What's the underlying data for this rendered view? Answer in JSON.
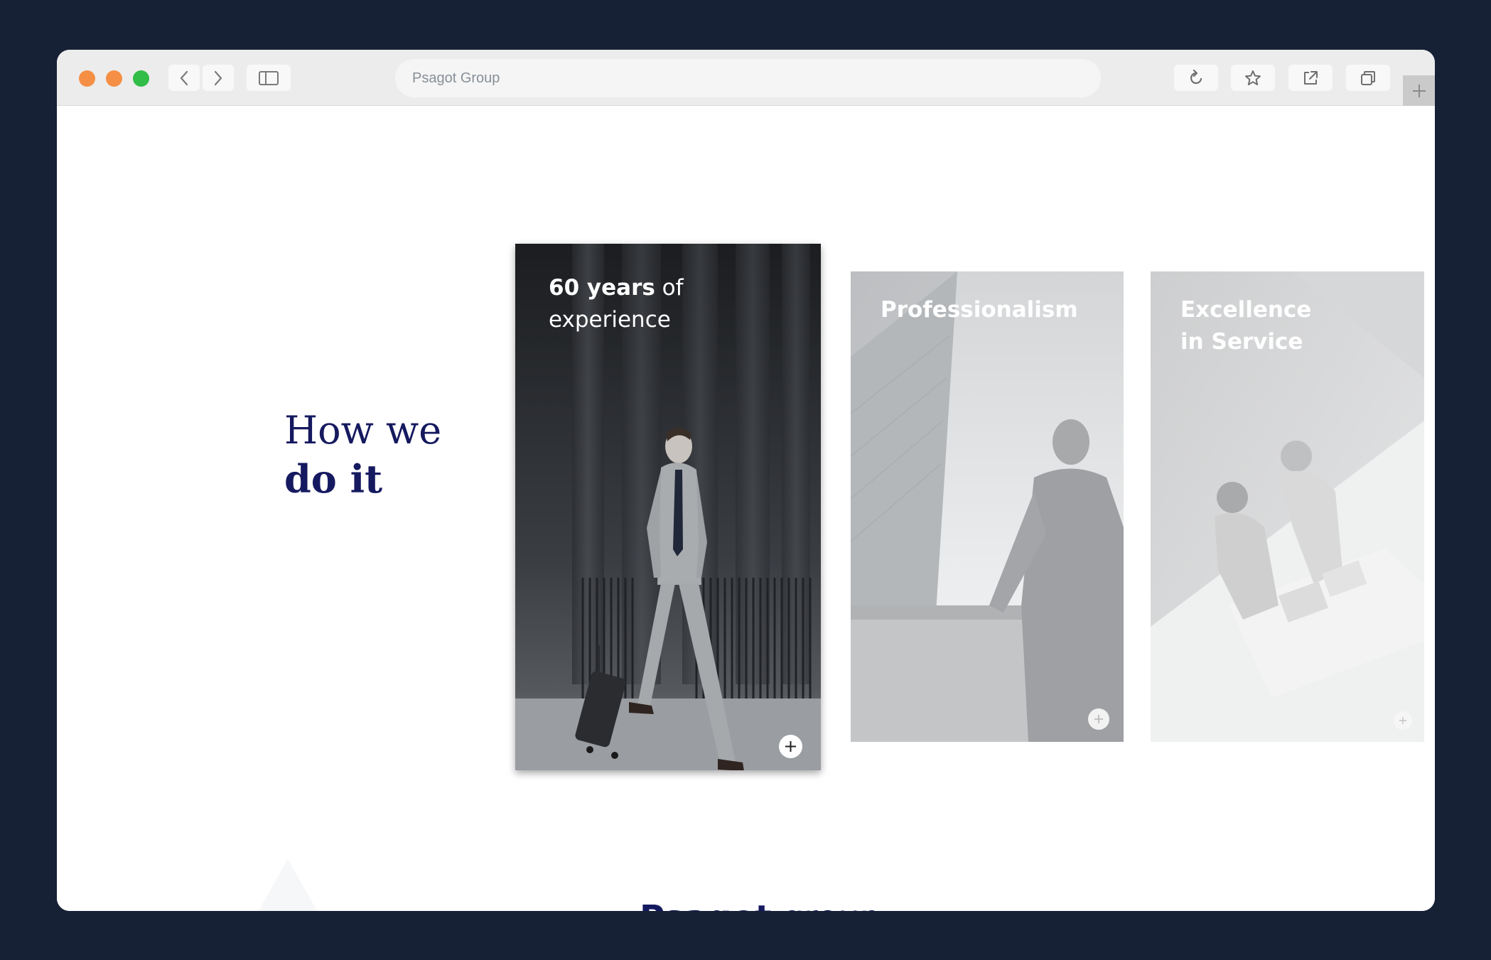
{
  "browser": {
    "address": "Psagot Group",
    "icons": [
      "back-arrow-icon",
      "forward-arrow-icon",
      "sidebar-icon",
      "reload-icon",
      "star-icon",
      "share-icon",
      "tabs-icon",
      "plus-icon"
    ]
  },
  "section": {
    "heading_line1": "How we",
    "heading_line2": "do it"
  },
  "cards": [
    {
      "title_bold": "60 years",
      "title_regular": " of",
      "title_line2": "experience",
      "action_icon": "plus-icon"
    },
    {
      "title": "Professionalism",
      "action_icon": "plus-icon"
    },
    {
      "title_line1": "Excellence",
      "title_line2": "in Service",
      "action_icon": "plus-icon"
    }
  ],
  "footer": {
    "brand": "Psagot",
    "suffix": " group"
  },
  "colors": {
    "page_background": "#172135",
    "brand_navy": "#15195f",
    "traffic_red": "#f58f45",
    "traffic_yellow": "#f58f45",
    "traffic_green": "#31bd47"
  }
}
